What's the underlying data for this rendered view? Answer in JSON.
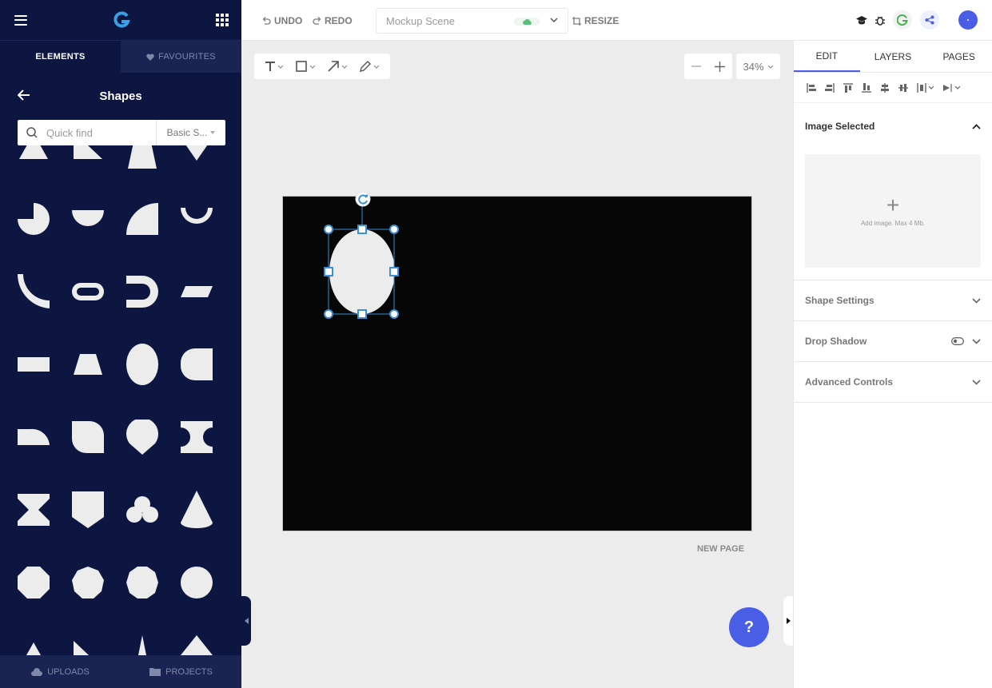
{
  "left_panel": {
    "tabs": [
      "ELEMENTS",
      "FAVOURITES"
    ],
    "section_title": "Shapes",
    "search_placeholder": "Quick find",
    "category": "Basic S...",
    "bottom_tabs": [
      "UPLOADS",
      "PROJECTS"
    ],
    "shape_names": [
      "triangle-shape",
      "bevel-triangle-shape",
      "trapezoid-shape",
      "down-triangle-shape",
      "pie-shape",
      "half-circle-shape",
      "quarter-circle-shape",
      "arc-shape",
      "curve-shape",
      "pill-outline-shape",
      "u-shape",
      "parallelogram-shape",
      "rectangle-shape",
      "trapezoid-shape",
      "ellipse-shape",
      "rounded-tab-shape",
      "half-disc-shape",
      "leaf-shape",
      "teardrop-shape",
      "bowtie-shape",
      "hourglass-shape",
      "shield-shape",
      "club-shape",
      "cone-shape",
      "octagon-shape",
      "nonagon-shape",
      "decagon-shape",
      "circle-shape",
      "triangle-shape",
      "right-triangle-shape",
      "spike-shape",
      "diamond-shape"
    ]
  },
  "topbar": {
    "undo": "UNDO",
    "redo": "REDO",
    "scene_name": "Mockup Scene",
    "resize": "RESIZE"
  },
  "canvas": {
    "zoom": "34%",
    "new_page": "NEW PAGE",
    "help": "?"
  },
  "right_panel": {
    "tabs": [
      "EDIT",
      "LAYERS",
      "PAGES"
    ],
    "sections": {
      "image_selected": "Image Selected",
      "add_image": "Add image. Max 4 Mb.",
      "shape_settings": "Shape Settings",
      "drop_shadow": "Drop Shadow",
      "advanced_controls": "Advanced Controls"
    }
  },
  "colors": {
    "sidebar_bg": "#0d1640",
    "accent": "#4a5de6",
    "selection": "#3b8fd6",
    "shape_fill": "#ececec"
  }
}
